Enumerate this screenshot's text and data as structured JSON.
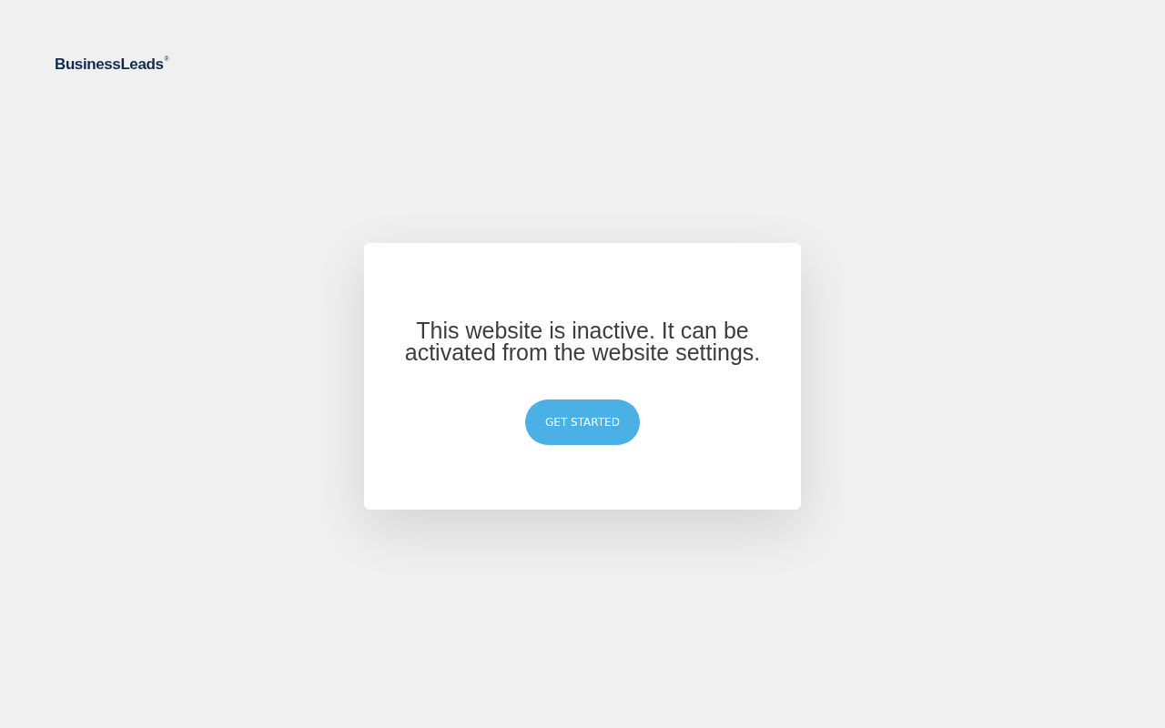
{
  "logo": {
    "text": "BusinessLeads$^{®}$"
  },
  "card": {
    "message": "This website is inactive. It can be activated from the website settings.",
    "button": "GET STARTED"
  }
}
